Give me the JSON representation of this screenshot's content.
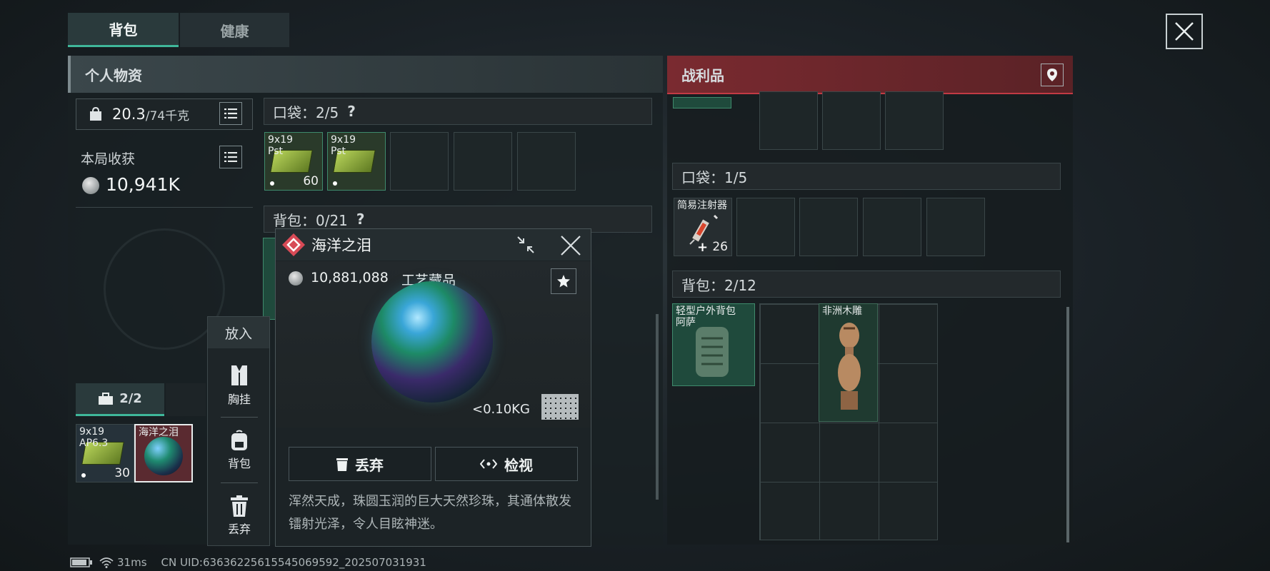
{
  "tabs": [
    "背包",
    "健康"
  ],
  "left_panel": {
    "title": "个人物资",
    "weight": "20.3",
    "weight_max": "/74千克",
    "earnings_label": "本局收获",
    "earnings_value": "10,941K",
    "pocket_label": "口袋：2/5",
    "pocket_help": "?",
    "backpack_label": "背包：0/21",
    "backpack_help": "?",
    "pocket_items": [
      {
        "line1": "9x19",
        "line2": "Pst",
        "count": "60"
      },
      {
        "line1": "9x19",
        "line2": "Pst",
        "count": ""
      }
    ],
    "safe_box_tab": "2/2",
    "safe_box_items": [
      {
        "line1": "9x19",
        "line2": "AP6.3",
        "count": "30"
      },
      {
        "line1": "海洋之泪",
        "line2": "",
        "count": ""
      }
    ]
  },
  "put_menu": {
    "title": "放入",
    "items": [
      {
        "label": "胸挂",
        "icon": "vest-icon"
      },
      {
        "label": "背包",
        "icon": "backpack-icon"
      },
      {
        "label": "丢弃",
        "icon": "trash-icon"
      }
    ]
  },
  "item_popup": {
    "name": "海洋之泪",
    "value": "10,881,088",
    "category": "工艺藏品",
    "weight": "<0.10KG",
    "discard_label": "丢弃",
    "inspect_label": "检视",
    "description": "浑然天成，珠圆玉润的巨大天然珍珠，其通体散发镭射光泽，令人目眩神迷。"
  },
  "right_panel": {
    "title": "战利品",
    "pocket_label": "口袋：1/5",
    "syringe_label": "简易注射器",
    "syringe_count": "26",
    "backpack_label": "背包：2/12",
    "backpack_item_label": "轻型户外背包",
    "backpack_item_sub": "阿萨",
    "statue_label": "非洲木雕"
  },
  "status_bar": {
    "ping": "31ms",
    "uid": "CN UID:636362256155450695​92_202507031931"
  },
  "colors": {
    "accent_green": "#3fb79a",
    "loot_red": "#7a2a30",
    "slot_green": "#1f4a3c"
  }
}
